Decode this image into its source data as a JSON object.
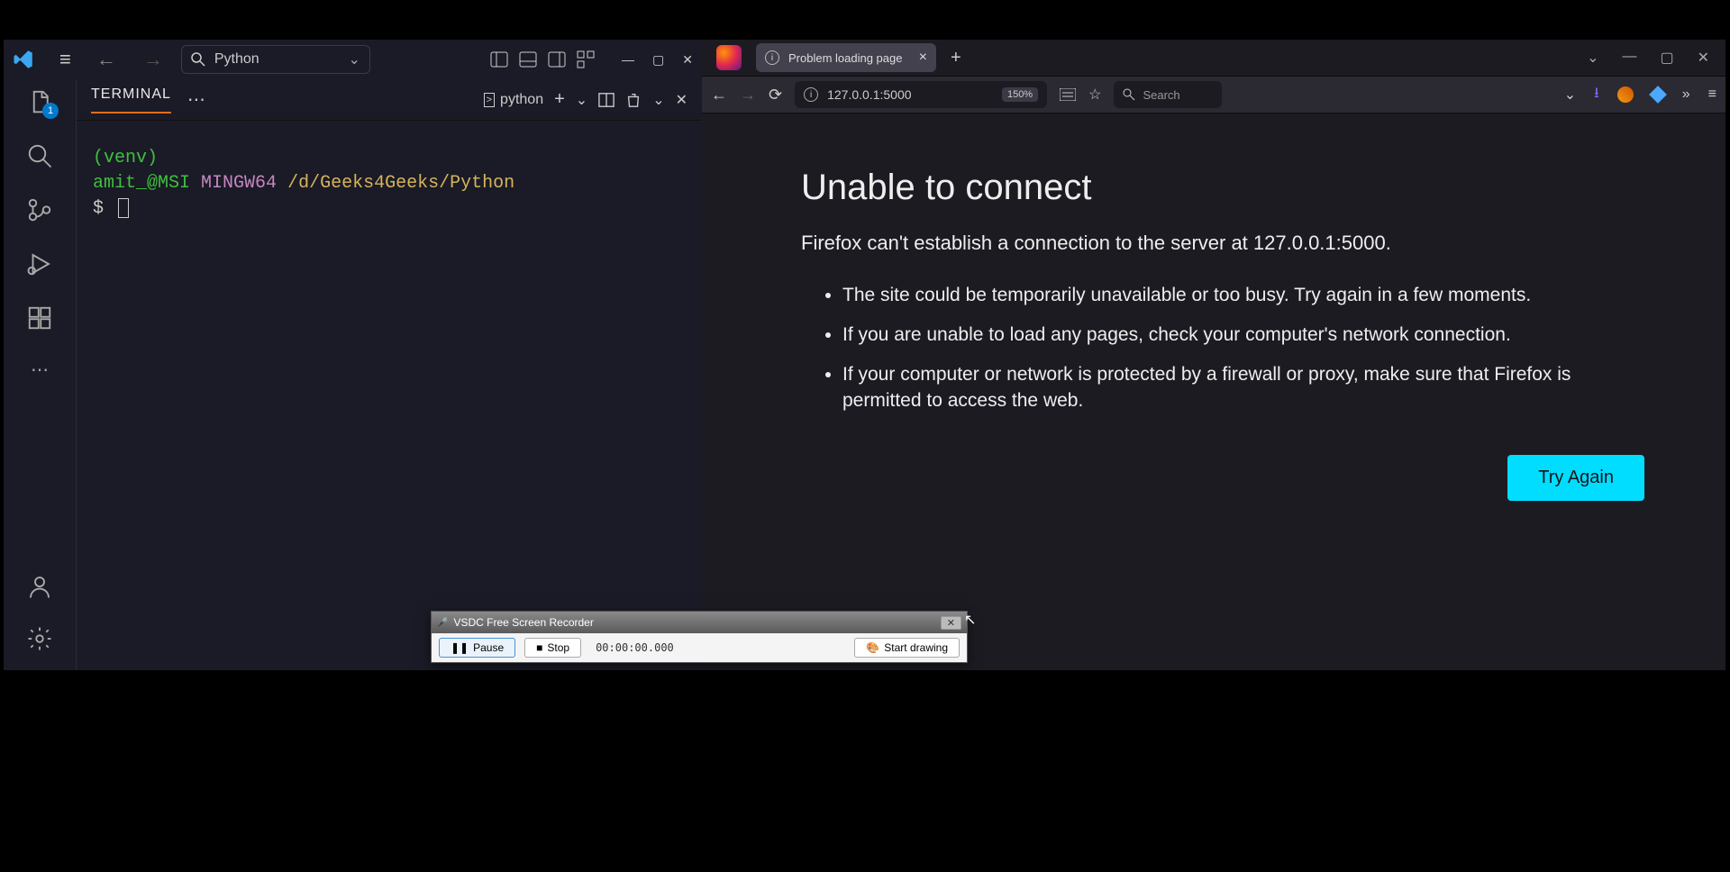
{
  "vscode": {
    "search_title": "Python",
    "terminal_tab": "TERMINAL",
    "terminal_shell": "python",
    "lines": {
      "venv": "(venv)",
      "user": "amit_@MSI",
      "host": "MINGW64",
      "path": "/d/Geeks4Geeks/Python",
      "prompt": "$"
    },
    "explorer_badge": "1"
  },
  "firefox": {
    "tab_title": "Problem loading page",
    "url": "127.0.0.1:5000",
    "zoom": "150%",
    "search_placeholder": "Search",
    "error": {
      "heading": "Unable to connect",
      "sub": "Firefox can't establish a connection to the server at 127.0.0.1:5000.",
      "bullets": [
        "The site could be temporarily unavailable or too busy. Try again in a few moments.",
        "If you are unable to load any pages, check your computer's network connection.",
        "If your computer or network is protected by a firewall or proxy, make sure that Firefox is permitted to access the web."
      ],
      "button": "Try Again"
    }
  },
  "vsdc": {
    "title": "VSDC Free Screen Recorder",
    "pause": "Pause",
    "stop": "Stop",
    "time": "00:00:00.000",
    "draw": "Start drawing"
  }
}
